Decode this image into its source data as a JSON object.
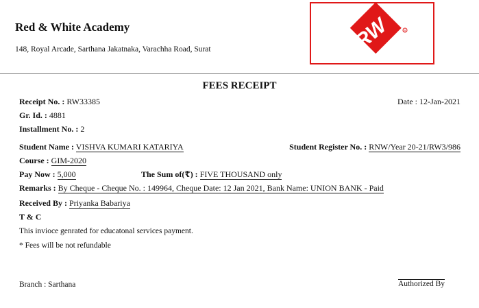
{
  "institute": {
    "name": "Red & White Academy",
    "address": "148, Royal Arcade, Sarthana Jakatnaka, Varachha Road, Surat",
    "logo_text": "RW",
    "logo_color": "#e01818"
  },
  "receipt": {
    "title": "FEES RECEIPT",
    "receipt_no_label": "Receipt No. :",
    "receipt_no": "RW33385",
    "date_label": "Date :",
    "date": "12-Jan-2021",
    "gr_id_label": "Gr. Id. :",
    "gr_id": "4881",
    "installment_label": "Installment No. :",
    "installment": "2",
    "student_name_label": "Student Name :",
    "student_name": "VISHVA KUMARI KATARIYA",
    "student_reg_label": "Student Register No. :",
    "student_reg": "RNW/Year 20-21/RW3/986",
    "course_label": "Course :",
    "course": "GIM-2020",
    "pay_now_label": "Pay Now :",
    "pay_now": "5,000",
    "sum_label": "The Sum of(₹) :",
    "sum_words": "FIVE THOUSAND only",
    "remarks_label": "Remarks :",
    "remarks": "By Cheque - Cheque No. : 149964, Cheque Date: 12 Jan 2021, Bank Name: UNION BANK - Paid",
    "received_by_label": "Received By :",
    "received_by": "Priyanka Babariya",
    "tc_label": "T & C",
    "tc_line1": "This invioce genrated for educatonal services payment.",
    "tc_line2": "* Fees will be not refundable",
    "branch_label": "Branch :",
    "branch": "Sarthana",
    "authorized": "Authorized By"
  }
}
